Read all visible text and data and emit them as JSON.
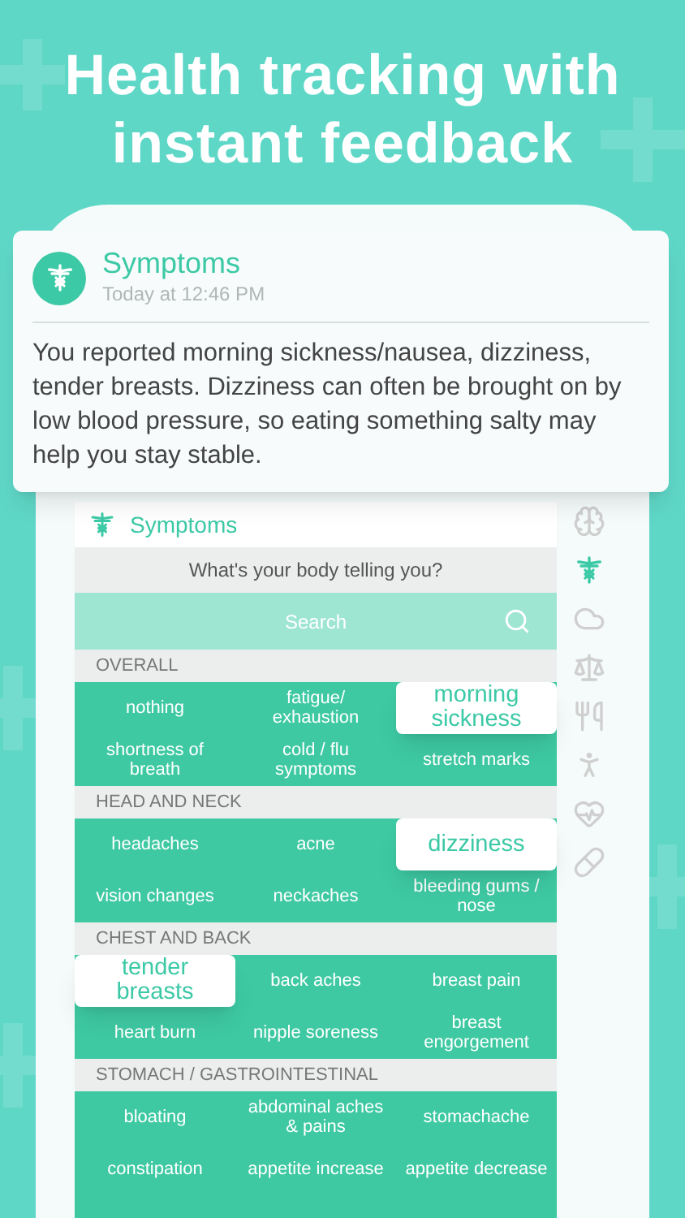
{
  "headline": "Health tracking with instant feedback",
  "notification": {
    "app": "Symptoms",
    "time": "Today at 12:46 PM",
    "message": "You reported morning sickness/nausea, dizziness, tender breasts. Dizziness can often be brought on by low blood pressure, so eating something salty may help you stay stable."
  },
  "screen": {
    "title": "Symptoms",
    "prompt": "What's your body telling you?",
    "search": {
      "placeholder": "Search"
    },
    "sections": [
      {
        "title": "OVERALL",
        "items": [
          {
            "label": "nothing",
            "selected": false
          },
          {
            "label": "fatigue/ exhaustion",
            "selected": false
          },
          {
            "label": "morning sickness",
            "selected": true
          },
          {
            "label": "shortness of breath",
            "selected": false
          },
          {
            "label": "cold / flu symptoms",
            "selected": false
          },
          {
            "label": "stretch marks",
            "selected": false
          }
        ]
      },
      {
        "title": "HEAD AND NECK",
        "items": [
          {
            "label": "headaches",
            "selected": false
          },
          {
            "label": "acne",
            "selected": false
          },
          {
            "label": "dizziness",
            "selected": true
          },
          {
            "label": "vision changes",
            "selected": false
          },
          {
            "label": "neckaches",
            "selected": false
          },
          {
            "label": "bleeding gums / nose",
            "selected": false
          }
        ]
      },
      {
        "title": "CHEST AND BACK",
        "items": [
          {
            "label": "tender breasts",
            "selected": true
          },
          {
            "label": "back aches",
            "selected": false
          },
          {
            "label": "breast pain",
            "selected": false
          },
          {
            "label": "heart burn",
            "selected": false
          },
          {
            "label": "nipple soreness",
            "selected": false
          },
          {
            "label": "breast engorgement",
            "selected": false
          }
        ]
      },
      {
        "title": "STOMACH / GASTROINTESTINAL",
        "items": [
          {
            "label": "bloating",
            "selected": false
          },
          {
            "label": "abdominal aches & pains",
            "selected": false
          },
          {
            "label": "stomachache",
            "selected": false
          },
          {
            "label": "constipation",
            "selected": false
          },
          {
            "label": "appetite increase",
            "selected": false
          },
          {
            "label": "appetite decrease",
            "selected": false
          }
        ]
      }
    ]
  },
  "sidebar": {
    "items": [
      {
        "selected": false
      },
      {
        "selected": true
      },
      {
        "selected": false
      },
      {
        "selected": false
      },
      {
        "selected": false
      },
      {
        "selected": false
      },
      {
        "selected": false
      },
      {
        "selected": false
      }
    ]
  }
}
